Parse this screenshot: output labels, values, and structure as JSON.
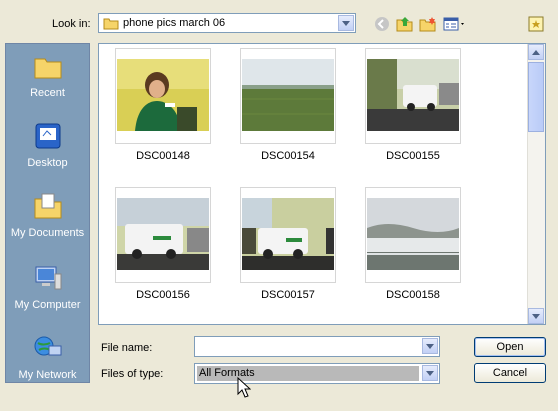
{
  "look_in": {
    "label": "Look in:",
    "value": "phone pics march 06"
  },
  "toolbar": {
    "icons": [
      "back-icon",
      "up-folder-icon",
      "new-folder-icon",
      "view-menu-icon",
      "tools-icon"
    ]
  },
  "places": [
    {
      "label": "Recent",
      "icon": "recent-folder-icon"
    },
    {
      "label": "Desktop",
      "icon": "desktop-icon"
    },
    {
      "label": "My Documents",
      "icon": "my-documents-icon"
    },
    {
      "label": "My Computer",
      "icon": "my-computer-icon"
    },
    {
      "label": "My Network",
      "icon": "my-network-icon"
    }
  ],
  "files": [
    {
      "name": "DSC00148"
    },
    {
      "name": "DSC00154"
    },
    {
      "name": "DSC00155"
    },
    {
      "name": "DSC00156"
    },
    {
      "name": "DSC00157"
    },
    {
      "name": "DSC00158"
    }
  ],
  "file_name": {
    "label": "File name:",
    "value": ""
  },
  "file_type": {
    "label": "Files of type:",
    "value": "All Formats"
  },
  "buttons": {
    "open": "Open",
    "cancel": "Cancel"
  }
}
